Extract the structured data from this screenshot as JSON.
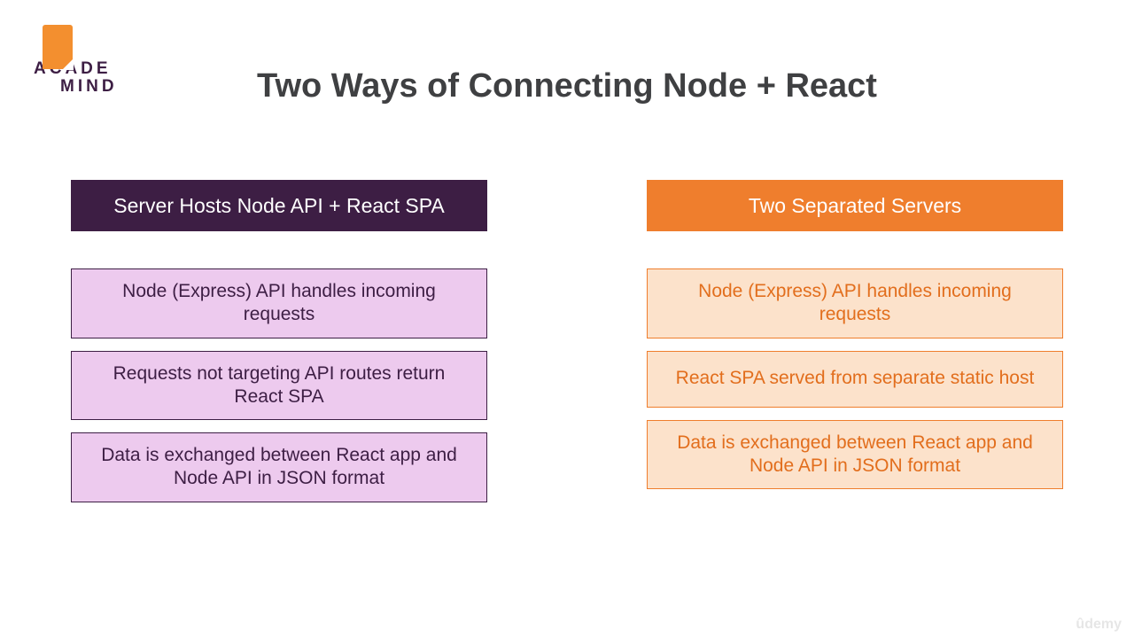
{
  "logo": {
    "line1": "ACADE",
    "line2": "MIND"
  },
  "title": "Two Ways of Connecting Node + React",
  "left": {
    "header": "Server Hosts Node API + React SPA",
    "items": [
      "Node (Express) API handles incoming requests",
      "Requests not targeting API routes return React SPA",
      "Data is exchanged between React app and Node API in JSON format"
    ]
  },
  "right": {
    "header": "Two Separated Servers",
    "items": [
      "Node (Express) API handles incoming requests",
      "React SPA served from separate static host",
      "Data is exchanged between React app and Node API in JSON format"
    ]
  },
  "watermark": "ûdemy"
}
